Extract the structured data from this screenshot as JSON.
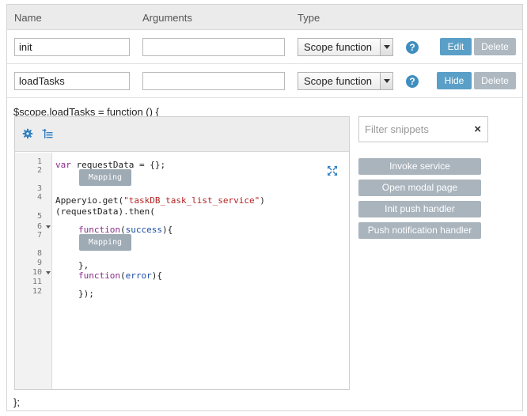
{
  "table": {
    "headers": {
      "name": "Name",
      "arguments": "Arguments",
      "type": "Type"
    },
    "rows": [
      {
        "name": "init",
        "arguments": "",
        "type": "Scope function",
        "help": "?",
        "toggle_label": "Edit",
        "delete_label": "Delete"
      },
      {
        "name": "loadTasks",
        "arguments": "",
        "type": "Scope function",
        "help": "?",
        "toggle_label": "Hide",
        "delete_label": "Delete"
      }
    ]
  },
  "editor": {
    "signature": "$scope.loadTasks = function () {",
    "closing": "};",
    "toolbar_icons": [
      "gear-icon",
      "indent-icon"
    ],
    "expand_icon": "expand-icon",
    "line_numbers": [
      "1",
      "2",
      "3",
      "4",
      "5",
      "6",
      "7",
      "8",
      "9",
      "10",
      "11",
      "12"
    ],
    "code": {
      "l1_kw": "var",
      "l1_rest": " requestData = {};",
      "l4_a": "Apperyio.get(",
      "l4_str": "\"taskDB_task_list_service\"",
      "l4_b": ")",
      "l4_c": "(requestData).then(",
      "l6_kw": "function",
      "l6_open": "(",
      "l6_param": "success",
      "l6_close": "){",
      "l9": "},",
      "l10_kw": "function",
      "l10_open": "(",
      "l10_param": "error",
      "l10_close": "){",
      "l12": "});"
    },
    "mapping_label": "Mapping"
  },
  "snippets": {
    "filter_placeholder": "Filter snippets",
    "clear": "×",
    "items": [
      "Invoke service",
      "Open modal page",
      "Init push handler",
      "Push notification handler"
    ]
  },
  "colors": {
    "accent": "#5a9fc7",
    "help": "#3e8fbf",
    "disabled": "#aeb8c0",
    "keyword": "#8b2a8c",
    "string": "#b22222",
    "param": "#1a4da8"
  }
}
